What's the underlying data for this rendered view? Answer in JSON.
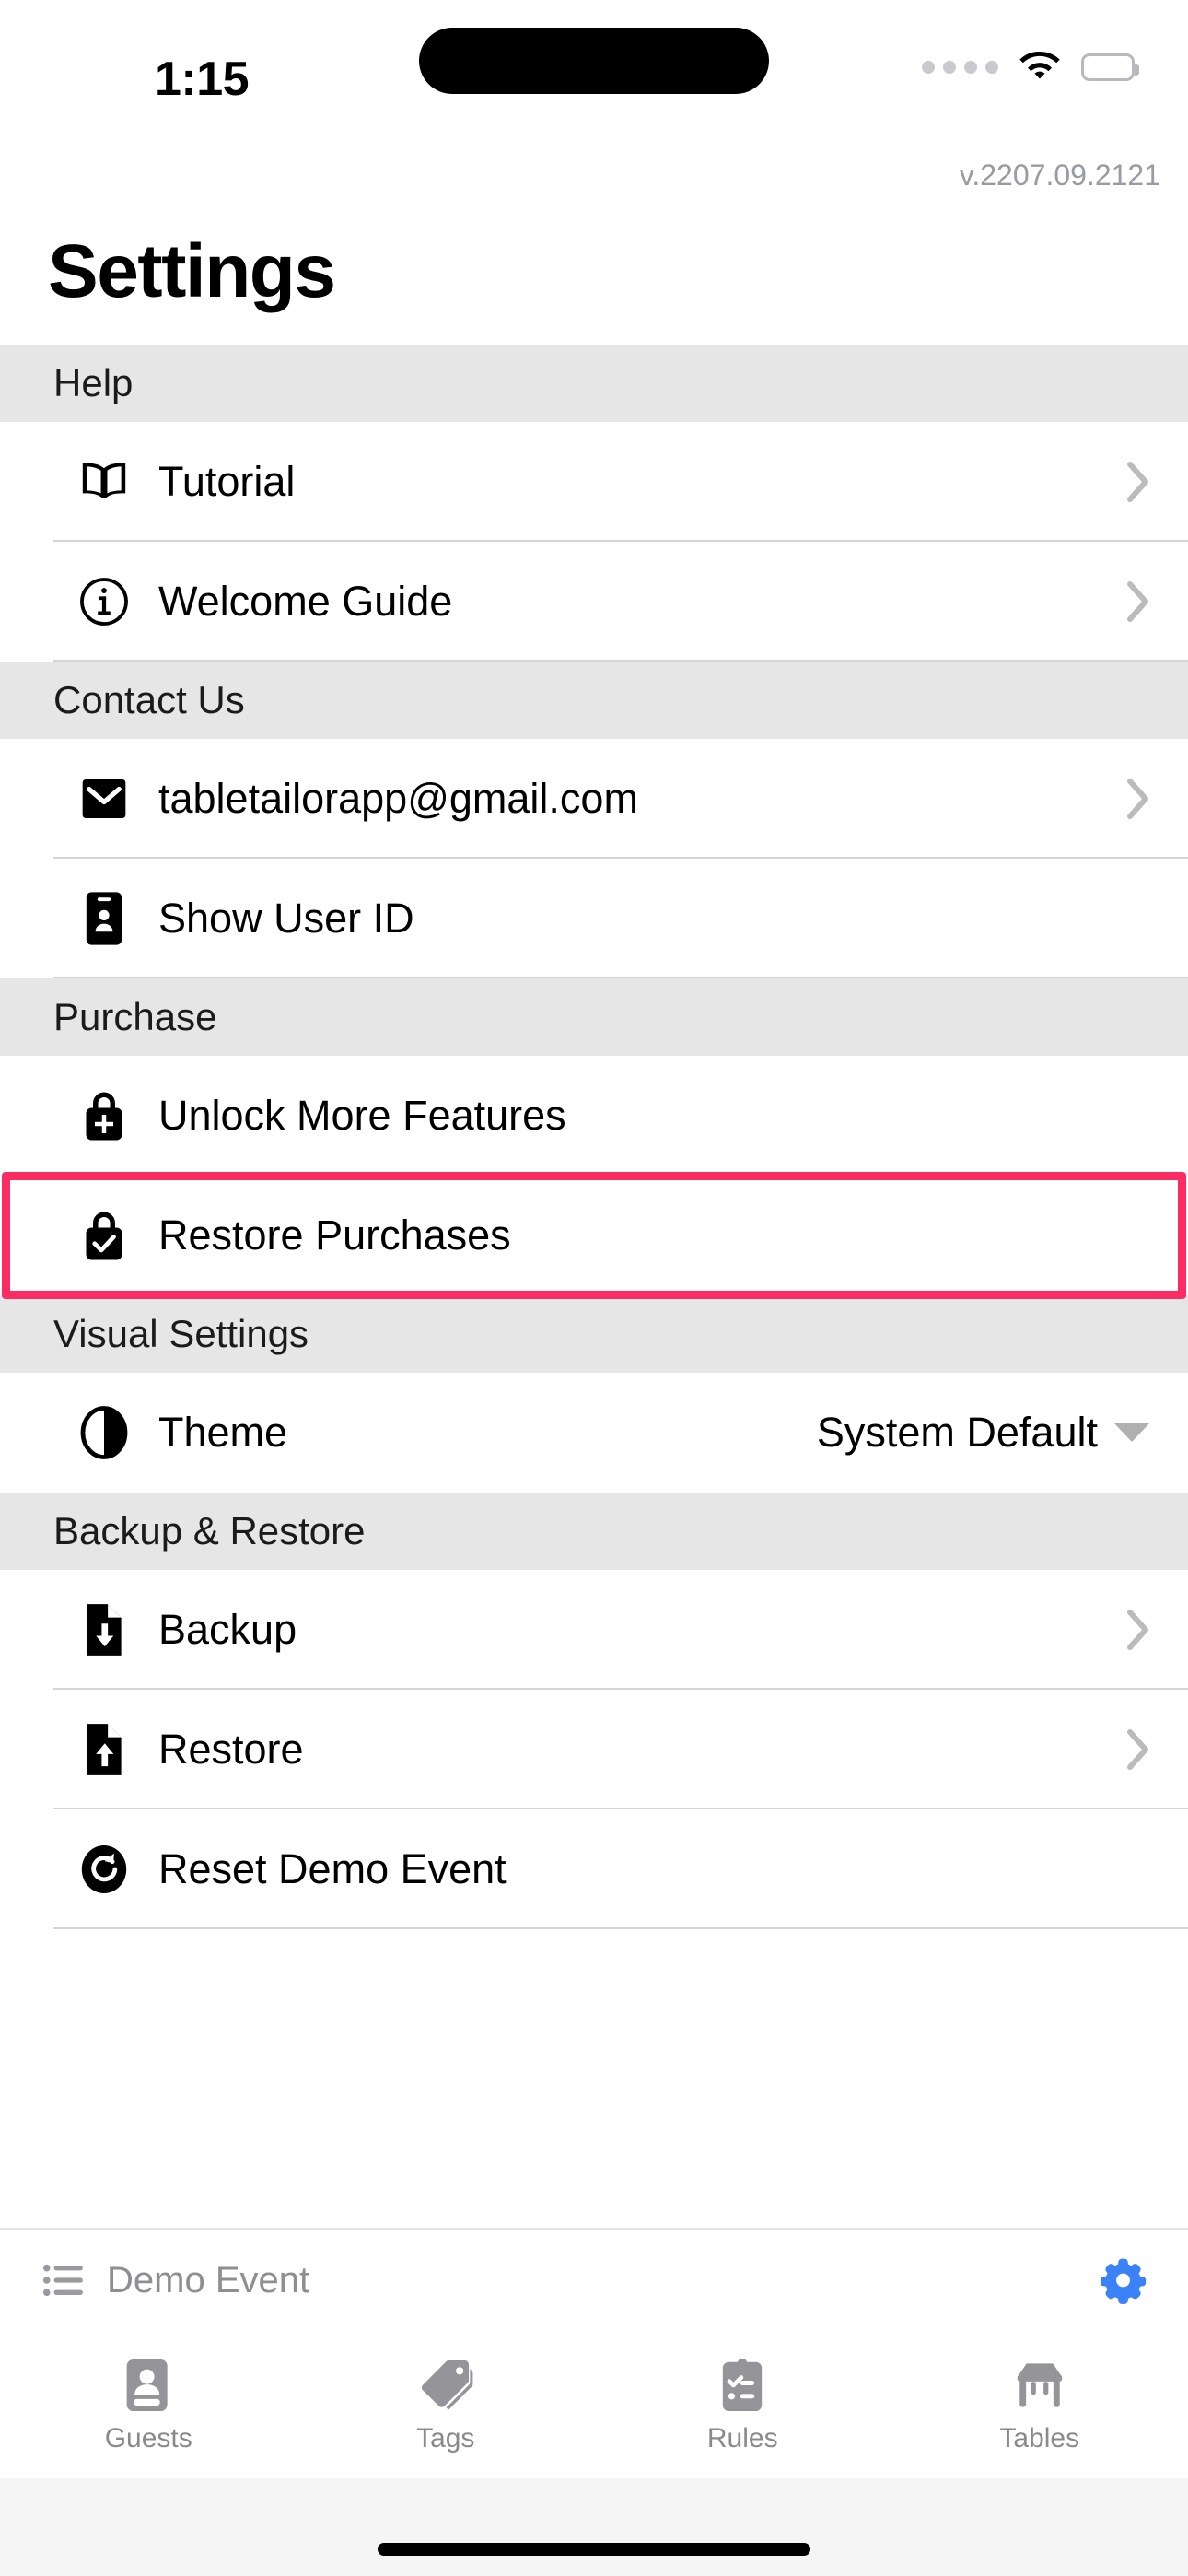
{
  "status_bar": {
    "time": "1:15",
    "cellular_icon": "cellular-dots-icon",
    "wifi_icon": "wifi-icon",
    "battery_icon": "battery-full-icon"
  },
  "header": {
    "version": "v.2207.09.2121",
    "title": "Settings"
  },
  "highlight_color": "#fb2c63",
  "accent_color": "#3b82f6",
  "sections": [
    {
      "title": "Help",
      "rows": [
        {
          "label": "Tutorial",
          "icon": "open-book-icon",
          "accessory": "chevron-right-icon"
        },
        {
          "label": "Welcome Guide",
          "icon": "info-circle-icon",
          "accessory": "chevron-right-icon"
        }
      ]
    },
    {
      "title": "Contact Us",
      "rows": [
        {
          "label": "tabletailorapp@gmail.com",
          "icon": "envelope-icon",
          "accessory": "chevron-right-icon"
        },
        {
          "label": "Show User ID",
          "icon": "id-card-icon",
          "accessory": "none"
        }
      ]
    },
    {
      "title": "Purchase",
      "rows": [
        {
          "label": "Unlock More Features",
          "icon": "lock-plus-icon",
          "accessory": "none"
        },
        {
          "label": "Restore Purchases",
          "icon": "lock-check-icon",
          "accessory": "none",
          "highlighted": true
        }
      ]
    },
    {
      "title": "Visual Settings",
      "rows": [
        {
          "label": "Theme",
          "icon": "contrast-circle-icon",
          "value": "System Default",
          "accessory": "caret-down-icon"
        }
      ]
    },
    {
      "title": "Backup & Restore",
      "rows": [
        {
          "label": "Backup",
          "icon": "file-download-icon",
          "accessory": "chevron-right-icon"
        },
        {
          "label": "Restore",
          "icon": "file-upload-icon",
          "accessory": "chevron-right-icon"
        },
        {
          "label": "Reset Demo Event",
          "icon": "refresh-circle-icon",
          "accessory": "none"
        }
      ]
    }
  ],
  "event_bar": {
    "list_icon": "list-icon",
    "event_name": "Demo Event",
    "settings_icon": "gear-icon"
  },
  "tab_bar": {
    "tabs": [
      {
        "label": "Guests",
        "icon": "contact-card-icon"
      },
      {
        "label": "Tags",
        "icon": "tag-icon"
      },
      {
        "label": "Rules",
        "icon": "clipboard-checklist-icon"
      },
      {
        "label": "Tables",
        "icon": "table-icon"
      }
    ]
  }
}
